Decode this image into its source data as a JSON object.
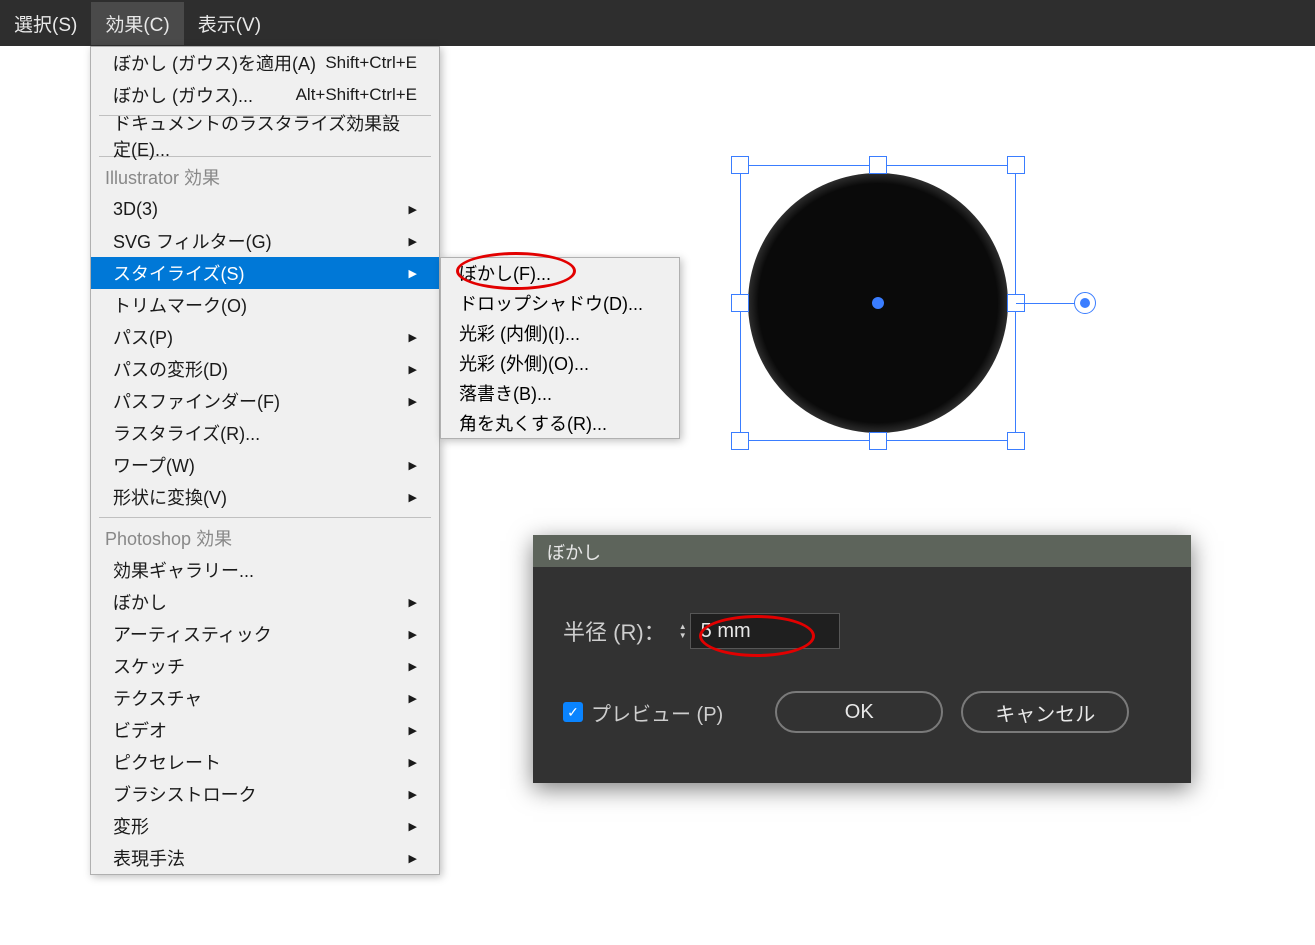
{
  "menubar": {
    "select": "選択(S)",
    "effect": "効果(C)",
    "view": "表示(V)"
  },
  "mainMenu": {
    "applyBlurGauss": "ぼかし (ガウス)を適用(A)",
    "applyBlurGaussShortcut": "Shift+Ctrl+E",
    "blurGauss": "ぼかし (ガウス)...",
    "blurGaussShortcut": "Alt+Shift+Ctrl+E",
    "docRaster": "ドキュメントのラスタライズ効果設定(E)...",
    "illustratorHeader": "Illustrator 効果",
    "threeD": "3D(3)",
    "svgFilter": "SVG フィルター(G)",
    "stylize": "スタイライズ(S)",
    "trimMark": "トリムマーク(O)",
    "path": "パス(P)",
    "pathDeform": "パスの変形(D)",
    "pathfinder": "パスファインダー(F)",
    "rasterize": "ラスタライズ(R)...",
    "warp": "ワープ(W)",
    "convertShape": "形状に変換(V)",
    "photoshopHeader": "Photoshop 効果",
    "effectGallery": "効果ギャラリー...",
    "blur": "ぼかし",
    "artistic": "アーティスティック",
    "sketch": "スケッチ",
    "texture": "テクスチャ",
    "video": "ビデオ",
    "pixelate": "ピクセレート",
    "brushStroke": "ブラシストローク",
    "deform": "変形",
    "expression": "表現手法"
  },
  "submenu": {
    "blur": "ぼかし(F)...",
    "dropShadow": "ドロップシャドウ(D)...",
    "innerGlow": "光彩 (内側)(I)...",
    "outerGlow": "光彩 (外側)(O)...",
    "scribble": "落書き(B)...",
    "roundCorner": "角を丸くする(R)..."
  },
  "dialog": {
    "title": "ぼかし",
    "radiusLabel": "半径 (R)：",
    "radiusValue": "5 mm",
    "previewLabel": "プレビュー (P)",
    "okLabel": "OK",
    "cancelLabel": "キャンセル"
  }
}
